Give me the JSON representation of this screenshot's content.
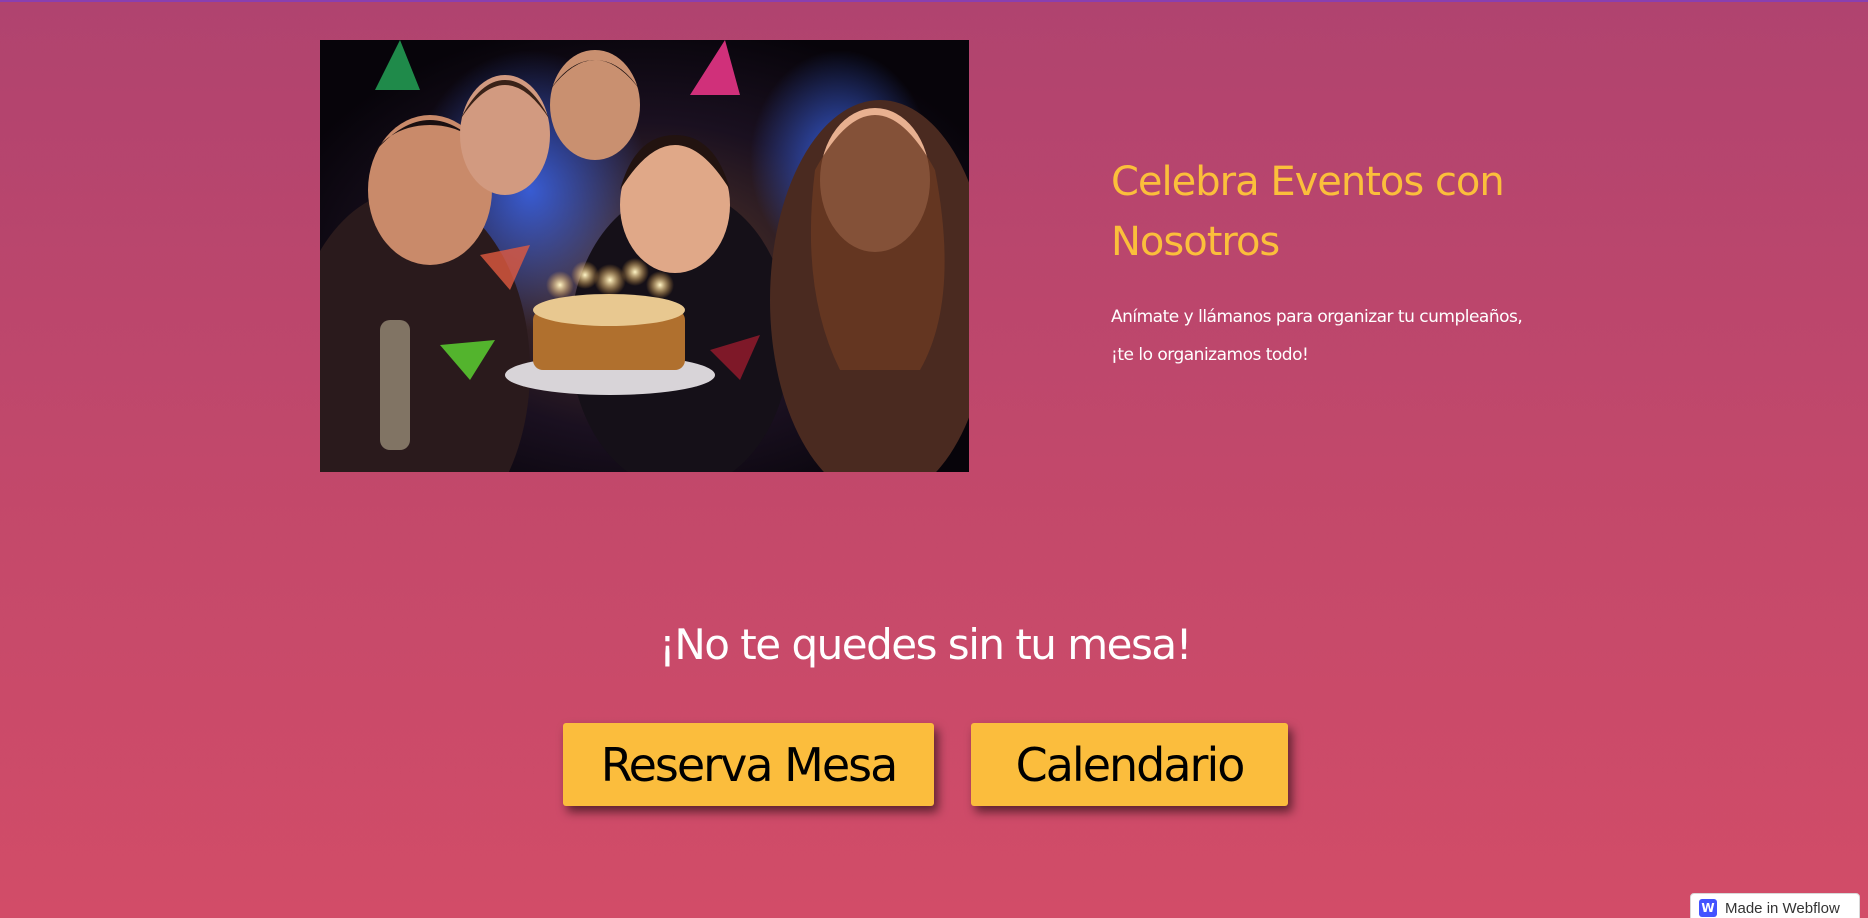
{
  "hero": {
    "image_alt": "Grupo de amigos celebrando un cumpleaños con pastel y velas"
  },
  "events": {
    "title": "Celebra Eventos con Nosotros",
    "description": "Anímate y llámanos para organizar tu cumpleaños, ¡te lo organizamos todo!"
  },
  "cta": {
    "heading": "¡No te quedes sin tu mesa!",
    "reserve_label": "Reserva Mesa",
    "calendar_label": "Calendario"
  },
  "badge": {
    "logo": "W",
    "label": "Made in Webflow"
  },
  "colors": {
    "background_top": "#b0436f",
    "background_bottom": "#d24c68",
    "accent": "#fbbf3b",
    "button": "#fbbd3d"
  }
}
